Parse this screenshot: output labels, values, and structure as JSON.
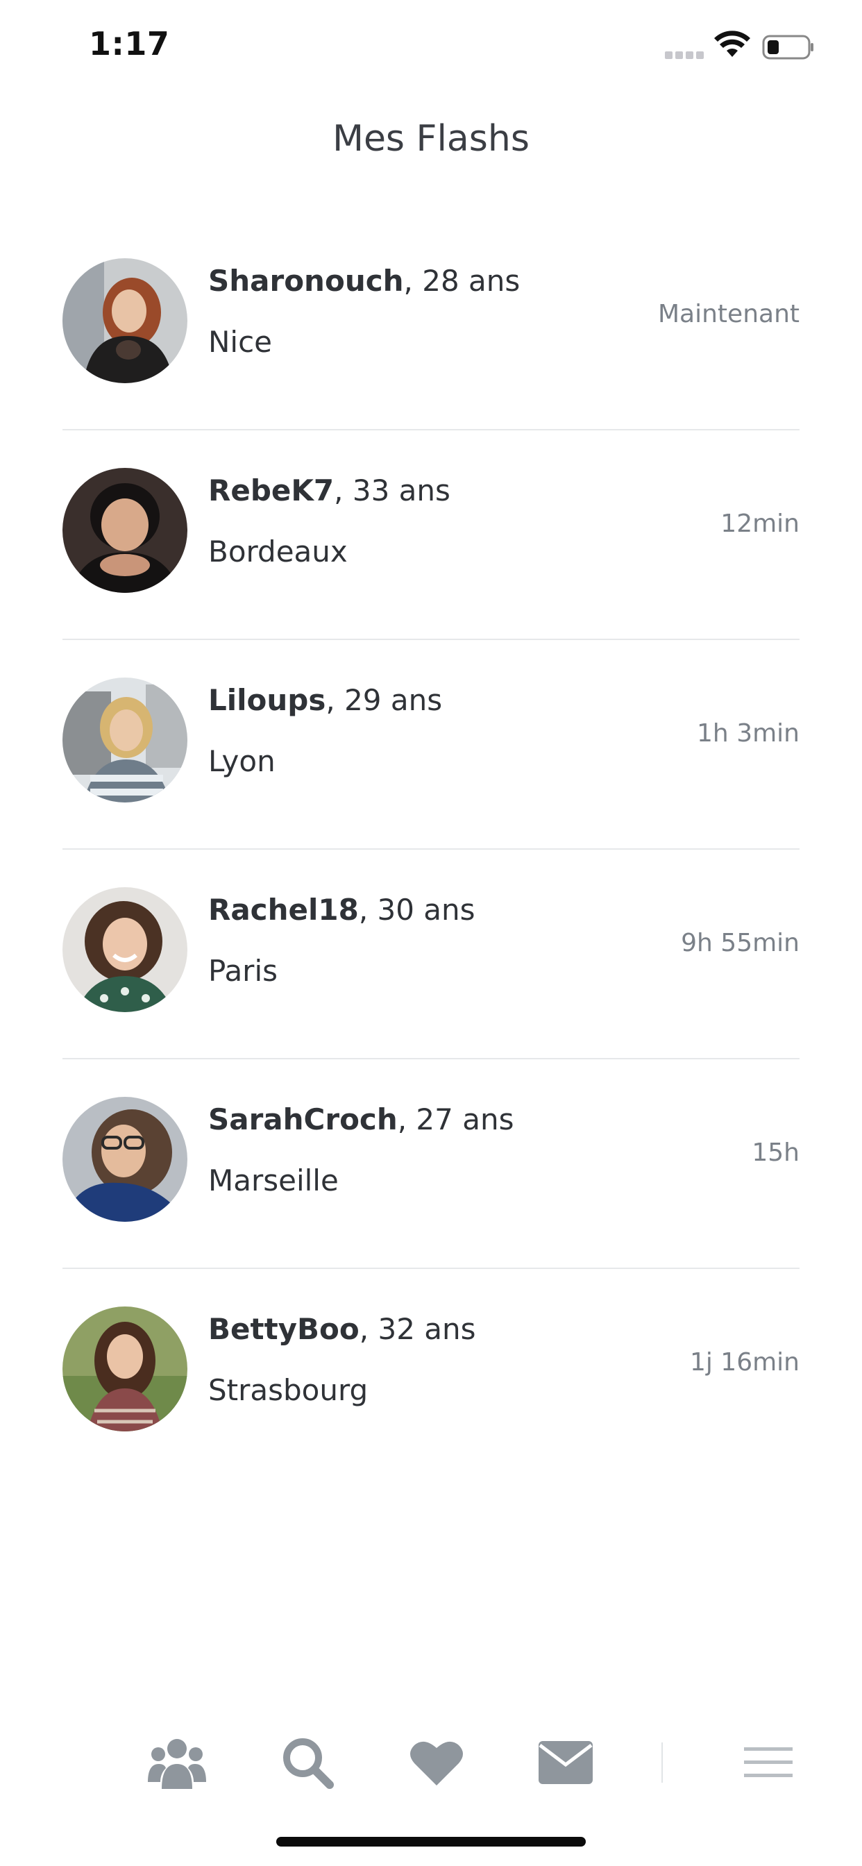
{
  "status_bar": {
    "time": "1:17"
  },
  "header": {
    "title": "Mes Flashs"
  },
  "flashes": [
    {
      "username": "Sharonouch",
      "age": ", 28 ans",
      "city": "Nice",
      "time_ago": "Maintenant"
    },
    {
      "username": "RebeK7",
      "age": ", 33 ans",
      "city": "Bordeaux",
      "time_ago": "12min"
    },
    {
      "username": "Liloups",
      "age": ", 29 ans",
      "city": "Lyon",
      "time_ago": "1h 3min"
    },
    {
      "username": "Rachel18",
      "age": ", 30 ans",
      "city": "Paris",
      "time_ago": "9h 55min"
    },
    {
      "username": "SarahCroch",
      "age": ", 27 ans",
      "city": "Marseille",
      "time_ago": "15h"
    },
    {
      "username": "BettyBoo",
      "age": ", 32 ans",
      "city": "Strasbourg",
      "time_ago": "1j 16min"
    }
  ],
  "tab_bar": {
    "icons": [
      "users-icon",
      "search-icon",
      "heart-icon",
      "envelope-icon",
      "menu-icon"
    ]
  },
  "colors": {
    "icon_gray": "#8f969d",
    "divider": "#e6e8ea",
    "text": "#2f3237",
    "secondary_text": "#7a8088"
  }
}
